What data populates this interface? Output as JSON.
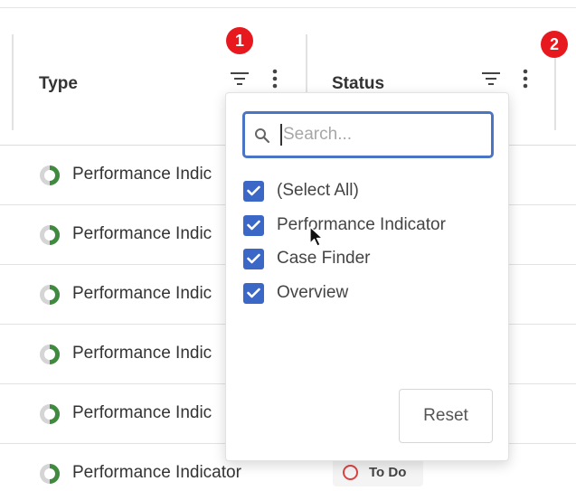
{
  "table": {
    "columns": [
      {
        "label": "Type"
      },
      {
        "label": "Status"
      }
    ],
    "rows": [
      {
        "type": "Performance Indic"
      },
      {
        "type": "Performance Indic"
      },
      {
        "type": "Performance Indic"
      },
      {
        "type": "Performance Indic"
      },
      {
        "type": "Performance Indic"
      },
      {
        "type": "Performance Indicator",
        "status": "To Do"
      }
    ]
  },
  "markers": [
    "1",
    "2"
  ],
  "filter_popup": {
    "search_placeholder": "Search...",
    "options": [
      {
        "label": "(Select All)",
        "checked": true
      },
      {
        "label": "Performance Indicator",
        "checked": true
      },
      {
        "label": "Case Finder",
        "checked": true
      },
      {
        "label": "Overview",
        "checked": true
      }
    ],
    "reset_label": "Reset"
  },
  "colors": {
    "accent": "#3b68c6",
    "marker": "#e8191e",
    "status_todo": "#d64545"
  },
  "icons": [
    "filter-icon",
    "kebab-menu-icon",
    "search-icon",
    "check-icon",
    "progress-ring-icon",
    "status-ring-icon",
    "mouse-pointer-icon"
  ]
}
